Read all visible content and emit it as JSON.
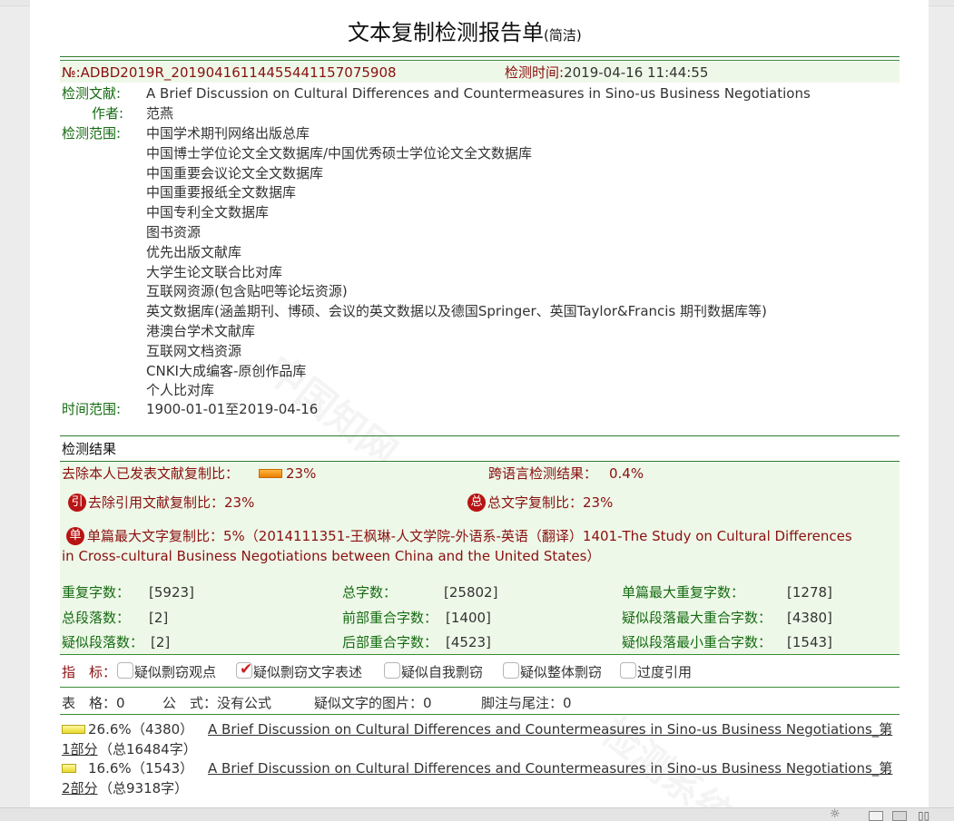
{
  "title": "文本复制检测报告单",
  "title_suffix": "(简洁)",
  "report_no": "№:ADBD2019R_20190416114455441157075908",
  "detect_time_label": "检测时间:",
  "detect_time_value": "2019-04-16 11:44:55",
  "doc_label": "检测文献:",
  "doc_title": "A Brief Discussion on Cultural Differences and Countermeasures in Sino-us Business Negotiations",
  "author_label": "作者:",
  "author": "范燕",
  "scope_label": "检测范围:",
  "scope_items": [
    "中国学术期刊网络出版总库",
    "中国博士学位论文全文数据库/中国优秀硕士学位论文全文数据库",
    "中国重要会议论文全文数据库",
    "中国重要报纸全文数据库",
    "中国专利全文数据库",
    "图书资源",
    "优先出版文献库",
    "大学生论文联合比对库",
    "互联网资源(包含贴吧等论坛资源)",
    "英文数据库(涵盖期刊、博硕、会议的英文数据以及德国Springer、英国Taylor&Francis 期刊数据库等)",
    "港澳台学术文献库",
    "互联网文档资源",
    "CNKI大成编客-原创作品库",
    "个人比对库"
  ],
  "time_range_label": "时间范围:",
  "time_range_value": "1900-01-01至2019-04-16",
  "results_header": "检测结果",
  "self_excluded_label": "去除本人已发表文献复制比：",
  "self_excluded_value": "23%",
  "self_excluded_fraction": 0.23,
  "cross_lang_label": "跨语言检测结果：",
  "cross_lang_value": "0.4%",
  "badge_yin": "引",
  "quote_excluded_label": "去除引用文献复制比：",
  "quote_excluded_value": "23%",
  "badge_zong": "总",
  "total_copy_label": "总文字复制比：",
  "total_copy_value": "23%",
  "badge_dan": "单",
  "single_max_label": "单篇最大文字复制比：",
  "single_max_line1": "5%（2014111351-王枫琳-人文学院-外语系-英语（翻译）1401-The Study on Cultural Differences",
  "single_max_line2": "in Cross-cultural Business Negotiations between China and the United States）",
  "stats": {
    "dup_chars_label": "重复字数：",
    "dup_chars_value": "[5923]",
    "total_chars_label": "总字数：",
    "total_chars_value": "[25802]",
    "max_single_dup_label": "单篇最大重复字数：",
    "max_single_dup_value": "[1278]",
    "total_paras_label": "总段落数：",
    "total_paras_value": "[2]",
    "front_overlap_label": "前部重合字数：",
    "front_overlap_value": "[1400]",
    "susp_para_max_label": "疑似段落最大重合字数：",
    "susp_para_max_value": "[4380]",
    "susp_paras_label": "疑似段落数：",
    "susp_paras_value": "[2]",
    "back_overlap_label": "后部重合字数：",
    "back_overlap_value": "[4523]",
    "susp_para_min_label": "疑似段落最小重合字数：",
    "susp_para_min_value": "[1543]"
  },
  "indicators_label": "指　标：",
  "indicators": [
    {
      "label": "疑似剽窃观点",
      "checked": false
    },
    {
      "label": "疑似剽窃文字表述",
      "checked": true
    },
    {
      "label": "疑似自我剽窃",
      "checked": false
    },
    {
      "label": "疑似整体剽窃",
      "checked": false
    },
    {
      "label": "过度引用",
      "checked": false
    }
  ],
  "misc": {
    "tables": "表　格：0",
    "formulas": "公　式：没有公式",
    "images": "疑似文字的图片：0",
    "footnotes": "脚注与尾注：0"
  },
  "parts": [
    {
      "percent": "26.6%",
      "fraction": 0.266,
      "count": "（4380）",
      "title": "A Brief Discussion on Cultural Differences and Countermeasures in Sino-us Business Negotiations_第",
      "title2": "1部分",
      "total": "（总16484字）"
    },
    {
      "percent": "16.6%",
      "fraction": 0.166,
      "count": "（1543）",
      "title": "A Brief Discussion on Cultural Differences and Countermeasures in Sino-us Business Negotiations_第",
      "title2": "2部分",
      "total": "（总9318字）"
    }
  ]
}
